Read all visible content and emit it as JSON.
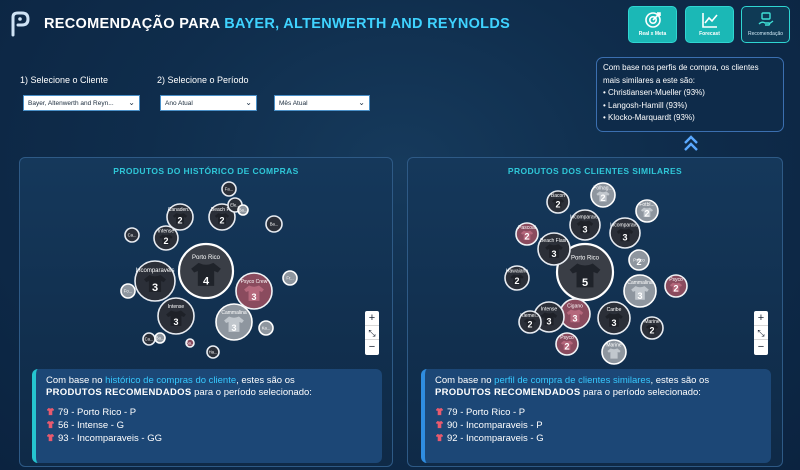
{
  "header": {
    "title_prefix": "RECOMENDAÇÃO PARA",
    "client_name": "BAYER, ALTENWERTH AND REYNOLDS",
    "nav": [
      {
        "label": "Real x Meta",
        "icon": "target-icon",
        "active": false
      },
      {
        "label": "Forecast",
        "icon": "line-chart-icon",
        "active": false
      },
      {
        "label": "Recomendação",
        "icon": "recommendation-icon",
        "active": true
      }
    ]
  },
  "filters": {
    "client_label": "1) Selecione o Cliente",
    "period_label": "2) Selecione o Período",
    "client_value": "Bayer, Altenwerth and Reyn...",
    "year_value": "Ano Atual",
    "month_value": "Mês Atual"
  },
  "similar": {
    "intro": "Com base nos perfis de compra, os clientes mais similares a este são:",
    "clients": [
      "Christiansen-Mueller (93%)",
      "Langosh-Hamill (93%)",
      "Klocko-Marquardt (93%)"
    ]
  },
  "panels": {
    "left_title": "PRODUTOS DO HISTÓRICO DE COMPRAS",
    "right_title": "PRODUTOS DOS CLIENTES SIMILARES"
  },
  "left_bubbles": [
    {
      "label": "Porto Rico",
      "num": "4",
      "kind": "feature"
    },
    {
      "label": "Incomparaveis",
      "num": "3",
      "kind": "dark"
    },
    {
      "label": "Intense",
      "num": "3",
      "kind": "dark"
    },
    {
      "label": "Cammalina",
      "num": "3",
      "kind": "light"
    },
    {
      "label": "Psyco Crew",
      "num": "3",
      "kind": "pink"
    },
    {
      "label": "Intense",
      "num": "2",
      "kind": "dark"
    },
    {
      "label": "Canaden...",
      "num": "2",
      "kind": "dark"
    },
    {
      "label": "Beach F...",
      "num": "2",
      "kind": "dark"
    },
    {
      "label": "Fa...",
      "num": "",
      "kind": "dark"
    },
    {
      "label": "Ele...",
      "num": "",
      "kind": "dark"
    },
    {
      "label": "Ba...",
      "num": "",
      "kind": "dark"
    },
    {
      "label": "Ca...",
      "num": "",
      "kind": "dark"
    },
    {
      "label": "Fo...",
      "num": "",
      "kind": "light"
    },
    {
      "label": "Fr...",
      "num": "",
      "kind": "light"
    },
    {
      "label": "Ka...",
      "num": "",
      "kind": "light"
    },
    {
      "label": "Ca...",
      "num": "",
      "kind": "dark"
    },
    {
      "label": "Ba...",
      "num": "",
      "kind": "light"
    },
    {
      "label": "Ba...",
      "num": "",
      "kind": "pink"
    },
    {
      "label": "Ha...",
      "num": "",
      "kind": "dark"
    },
    {
      "label": "Ba...",
      "num": "",
      "kind": "light"
    }
  ],
  "right_bubbles": [
    {
      "label": "Porto Rico",
      "num": "5",
      "kind": "feature"
    },
    {
      "label": "Incomparav...",
      "num": "3",
      "kind": "dark"
    },
    {
      "label": "Incomparav...",
      "num": "3",
      "kind": "dark"
    },
    {
      "label": "Beach Flash",
      "num": "3",
      "kind": "dark"
    },
    {
      "label": "Caribe",
      "num": "3",
      "kind": "dark"
    },
    {
      "label": "Cigano",
      "num": "3",
      "kind": "pink"
    },
    {
      "label": "Cammalina",
      "num": "3",
      "kind": "light"
    },
    {
      "label": "Intense",
      "num": "3",
      "kind": "dark"
    },
    {
      "label": "Bacon",
      "num": "2",
      "kind": "dark"
    },
    {
      "label": "Fotbl...",
      "num": "2",
      "kind": "light"
    },
    {
      "label": "Folhag...",
      "num": "2",
      "kind": "light"
    },
    {
      "label": "Pascoal",
      "num": "2",
      "kind": "pink"
    },
    {
      "label": "Hawaiana",
      "num": "2",
      "kind": "dark"
    },
    {
      "label": "Psyco",
      "num": "2",
      "kind": "light"
    },
    {
      "label": "Psyco",
      "num": "2",
      "kind": "pink"
    },
    {
      "label": "Klemei...",
      "num": "2",
      "kind": "dark"
    },
    {
      "label": "Marine",
      "num": "2",
      "kind": "dark"
    },
    {
      "label": "Psyco",
      "num": "2",
      "kind": "pink"
    },
    {
      "label": "Marine",
      "num": "",
      "kind": "light"
    }
  ],
  "recommendations": {
    "left": {
      "intro_prefix": "Com base no ",
      "intro_highlight": "histórico de compras do cliente",
      "intro_suffix": ", estes são os",
      "line2_bold": "PRODUTOS RECOMENDADOS",
      "line2_rest": " para o período selecionado:",
      "items": [
        "79 - Porto Rico - P",
        "56 - Intense - G",
        "93 - Incomparaveis - GG"
      ]
    },
    "right": {
      "intro_prefix": "Com base no ",
      "intro_highlight": "perfil de compra de clientes similares",
      "intro_suffix": ", estes são os",
      "line2_bold": "PRODUTOS RECOMENDADOS",
      "line2_rest": " para o período selecionado:",
      "items": [
        "79 - Porto Rico - P",
        "90 - Incomparaveis - P",
        "92 - Incomparaveis - G"
      ]
    }
  },
  "zoom": {
    "plus": "+",
    "reset": "⤡",
    "minus": "−"
  },
  "colors": {
    "accent": "#3fd3ff",
    "teal": "#1bb8b6",
    "panel_title": "#2fc7d8",
    "background": "#0f2d4c"
  }
}
